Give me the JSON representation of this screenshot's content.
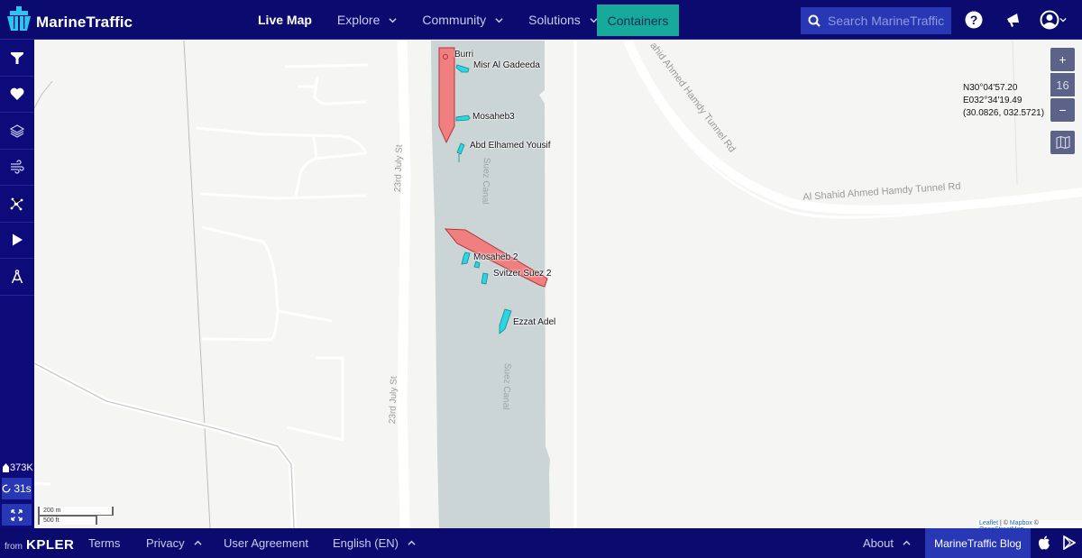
{
  "header": {
    "brand": "MarineTraffic",
    "nav": [
      {
        "label": "Live Map",
        "active": true,
        "dropdown": false
      },
      {
        "label": "Explore",
        "active": false,
        "dropdown": true
      },
      {
        "label": "Community",
        "active": false,
        "dropdown": true
      },
      {
        "label": "Solutions",
        "active": false,
        "dropdown": true
      }
    ],
    "containers_label": "Containers",
    "search_placeholder": "Search MarineTraffic",
    "icons": [
      "search-icon",
      "help-icon",
      "announcements-icon",
      "user-account-icon"
    ]
  },
  "sidebar": {
    "items": [
      {
        "name": "filters",
        "icon": "filter-icon"
      },
      {
        "name": "my-fleets",
        "icon": "heart-icon"
      },
      {
        "name": "layers",
        "icon": "layers-icon"
      },
      {
        "name": "weather",
        "icon": "wind-icon"
      },
      {
        "name": "density-routes",
        "icon": "network-icon"
      },
      {
        "name": "playback",
        "icon": "play-icon"
      },
      {
        "name": "measure",
        "icon": "compass-icon"
      }
    ],
    "vessel_count": "373K",
    "refresh_label": "31s"
  },
  "map": {
    "zoom_level": "16",
    "zoom_in": "+",
    "zoom_out": "−",
    "coordinates": {
      "dms_lat": "N30°04'57.20",
      "dms_lon": "E032°34'19.49",
      "decimal": "(30.0826, 032.5721)"
    },
    "scale": {
      "metric": "200 m",
      "imperial": "500 ft"
    },
    "attribution": {
      "leaflet": "Leaflet",
      "sep": " | © ",
      "mapbox": "Mapbox",
      "sep2": " © ",
      "osm": "OpenStreetMap"
    },
    "road_labels": {
      "street_a": "23rd July St",
      "canal": "Suez Canal",
      "tunnel_rd_1": "ahid Ahmed Hamdy Tunnel Rd",
      "tunnel_rd_2": "Al Shahid Ahmed Hamdy Tunnel Rd"
    },
    "vessels": [
      {
        "name": "Burri",
        "type": "tanker",
        "color": "#f08080"
      },
      {
        "name": "Misr Al Gadeeda",
        "type": "tug",
        "color": "#2bd6e0"
      },
      {
        "name": "Mosaheb3",
        "type": "tug",
        "color": "#2bd6e0"
      },
      {
        "name": "Abd Elhamed Yousif",
        "type": "tug",
        "color": "#2bd6e0"
      },
      {
        "name": "Mosaheb 2",
        "type": "tug",
        "color": "#2bd6e0"
      },
      {
        "name": "Svitzer Suez 2",
        "type": "tanker",
        "color": "#f08080"
      },
      {
        "name": "Ezzat Adel",
        "type": "tug",
        "color": "#2bd6e0"
      }
    ]
  },
  "footer": {
    "from": "from",
    "company": "KPLER",
    "links": [
      {
        "label": "Terms",
        "dropdown": false
      },
      {
        "label": "Privacy",
        "dropdown": true
      },
      {
        "label": "User Agreement",
        "dropdown": false
      },
      {
        "label": "English (EN)",
        "dropdown": true
      },
      {
        "label": "About",
        "dropdown": true
      }
    ],
    "blog_label": "MarineTraffic Blog",
    "app_icons": [
      "apple-icon",
      "google-play-icon"
    ]
  },
  "colors": {
    "brand_navy": "#0b0a6e",
    "accent_teal": "#17a99a",
    "search_blue": "#2838b4",
    "tanker_red": "#f08080",
    "tug_cyan": "#2bd6e0",
    "water": "#ccd5d6"
  }
}
